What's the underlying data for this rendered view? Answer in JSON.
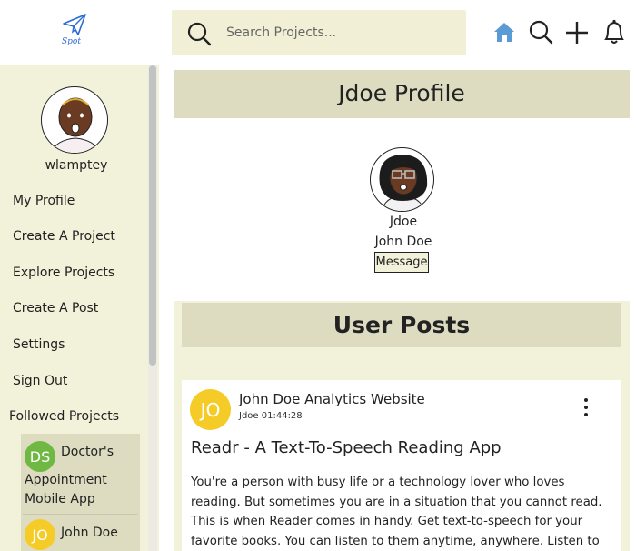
{
  "header": {
    "logo_text": "Spot",
    "search_placeholder": "Search Projects...",
    "icons": [
      "home-icon",
      "search-icon",
      "plus-icon",
      "bell-icon"
    ],
    "accent": "#5b9bd5"
  },
  "sidebar": {
    "username": "wlamptey",
    "links": [
      "My Profile",
      "Create A Project",
      "Explore Projects",
      "Create A Post",
      "Settings",
      "Sign Out"
    ],
    "followed_title": "Followed Projects",
    "followed": [
      {
        "initials": "DS",
        "line1": "Doctor's",
        "line2": "Appointment",
        "line3": "Mobile App",
        "color": "#70b844"
      },
      {
        "initials": "JO",
        "line1": "John Doe",
        "color": "#f5cc27"
      }
    ]
  },
  "profile": {
    "title": "Jdoe Profile",
    "handle": "Jdoe",
    "name": "John Doe",
    "message_label": "Message"
  },
  "posts": {
    "title": "User Posts",
    "items": [
      {
        "initials": "JO",
        "project": "John Doe Analytics Website",
        "meta": "Jdoe 01:44:28",
        "title": "Readr - A Text-To-Speech Reading App",
        "body": "You're a person with busy life or a technology lover who loves reading. But sometimes you are in a situation that you cannot read. This is when Reader comes in handy. Get text-to-speech for your favorite books. You can listen to them anytime, anywhere. Listen to the audiobook with just"
      }
    ]
  },
  "colors": {
    "cream": "#f2f1d9",
    "banner": "#dddcc0",
    "search_bg": "#f1f0d6"
  }
}
